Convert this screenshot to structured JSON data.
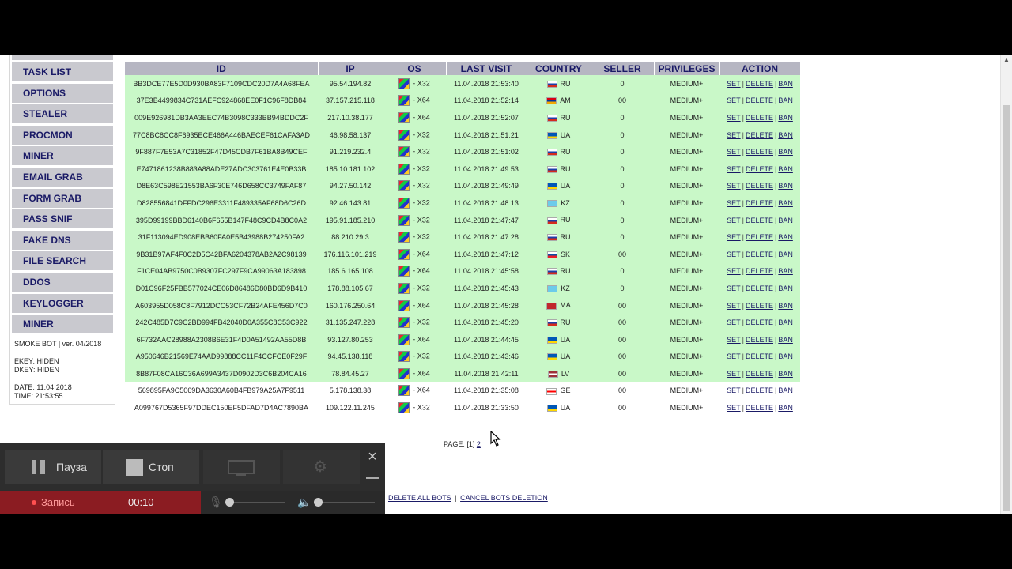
{
  "sidebar": {
    "items": [
      "TASK LIST",
      "OPTIONS",
      "STEALER",
      "PROCMON",
      "MINER",
      "EMAIL GRAB",
      "FORM GRAB",
      "PASS SNIF",
      "FAKE DNS",
      "FILE SEARCH",
      "DDOS",
      "KEYLOGGER",
      "MINER"
    ],
    "version": "SMOKE BOT | ver. 04/2018",
    "ekey": "EKEY: HIDEN",
    "dkey": "DKEY: HIDEN",
    "date": "DATE: 11.04.2018",
    "time": "TIME: 21:53:55"
  },
  "table": {
    "headers": [
      "ID",
      "IP",
      "OS",
      "LAST VISIT",
      "COUNTRY",
      "SELLER",
      "PRIVILEGES",
      "ACTION"
    ],
    "actions": {
      "set": "SET",
      "delete": "DELETE",
      "ban": "BAN",
      "sep": "|"
    },
    "rows": [
      {
        "id": "BB3DCE77E5D0D930BA83F7109CDC20D7A4A68FEA",
        "ip": "95.54.194.82",
        "os": "- X32",
        "visit": "11.04.2018 21:53:40",
        "country": "RU",
        "seller": "0",
        "priv": "MEDIUM+",
        "style": "green"
      },
      {
        "id": "37E3B4499834C731AEFC924868EE0F1C96F8DB84",
        "ip": "37.157.215.118",
        "os": "- X64",
        "visit": "11.04.2018 21:52:14",
        "country": "AM",
        "seller": "00",
        "priv": "MEDIUM+",
        "style": "green"
      },
      {
        "id": "009E926981DB3AA3EEC74B3098C333BB94BDDC2F",
        "ip": "217.10.38.177",
        "os": "- X64",
        "visit": "11.04.2018 21:52:07",
        "country": "RU",
        "seller": "0",
        "priv": "MEDIUM+",
        "style": "green"
      },
      {
        "id": "77C8BC8CC8F6935ECE466A446BAECEF61CAFA3AD",
        "ip": "46.98.58.137",
        "os": "- X32",
        "visit": "11.04.2018 21:51:21",
        "country": "UA",
        "seller": "0",
        "priv": "MEDIUM+",
        "style": "green"
      },
      {
        "id": "9F887F7E53A7C31852F47D45CDB7F61BA8B49CEF",
        "ip": "91.219.232.4",
        "os": "- X32",
        "visit": "11.04.2018 21:51:02",
        "country": "RU",
        "seller": "0",
        "priv": "MEDIUM+",
        "style": "green"
      },
      {
        "id": "E7471861238B883A88ADE27ADC303761E4E0B33B",
        "ip": "185.10.181.102",
        "os": "- X32",
        "visit": "11.04.2018 21:49:53",
        "country": "RU",
        "seller": "0",
        "priv": "MEDIUM+",
        "style": "green"
      },
      {
        "id": "D8E63C598E21553BA6F30E746D658CC3749FAF87",
        "ip": "94.27.50.142",
        "os": "- X32",
        "visit": "11.04.2018 21:49:49",
        "country": "UA",
        "seller": "0",
        "priv": "MEDIUM+",
        "style": "green"
      },
      {
        "id": "D828556841DFFDC296E3311F489335AF68D6C26D",
        "ip": "92.46.143.81",
        "os": "- X32",
        "visit": "11.04.2018 21:48:13",
        "country": "KZ",
        "seller": "0",
        "priv": "MEDIUM+",
        "style": "green"
      },
      {
        "id": "395D99199BBD6140B6F655B147F48C9CD4B8C0A2",
        "ip": "195.91.185.210",
        "os": "- X32",
        "visit": "11.04.2018 21:47:47",
        "country": "RU",
        "seller": "0",
        "priv": "MEDIUM+",
        "style": "green"
      },
      {
        "id": "31F113094ED908EBB60FA0E5B43988B274250FA2",
        "ip": "88.210.29.3",
        "os": "- X32",
        "visit": "11.04.2018 21:47:28",
        "country": "RU",
        "seller": "0",
        "priv": "MEDIUM+",
        "style": "green"
      },
      {
        "id": "9B31B97AF4F0C2D5C42BFA6204378AB2A2C98139",
        "ip": "176.116.101.219",
        "os": "- X64",
        "visit": "11.04.2018 21:47:12",
        "country": "SK",
        "seller": "00",
        "priv": "MEDIUM+",
        "style": "green"
      },
      {
        "id": "F1CE04AB9750C0B9307FC297F9CA99063A183898",
        "ip": "185.6.165.108",
        "os": "- X64",
        "visit": "11.04.2018 21:45:58",
        "country": "RU",
        "seller": "0",
        "priv": "MEDIUM+",
        "style": "green"
      },
      {
        "id": "D01C96F25FBB577024CE06D86486D80BD6D9B410",
        "ip": "178.88.105.67",
        "os": "- X32",
        "visit": "11.04.2018 21:45:43",
        "country": "KZ",
        "seller": "0",
        "priv": "MEDIUM+",
        "style": "green"
      },
      {
        "id": "A603955D058C8F7912DCC53CF72B24AFE456D7C0",
        "ip": "160.176.250.64",
        "os": "- X64",
        "visit": "11.04.2018 21:45:28",
        "country": "MA",
        "seller": "00",
        "priv": "MEDIUM+",
        "style": "green"
      },
      {
        "id": "242C485D7C9C2BD994FB42040D0A355C8C53C922",
        "ip": "31.135.247.228",
        "os": "- X32",
        "visit": "11.04.2018 21:45:20",
        "country": "RU",
        "seller": "00",
        "priv": "MEDIUM+",
        "style": "green"
      },
      {
        "id": "6F732AAC28988A2308B6E31F4D0A51492AA55D8B",
        "ip": "93.127.80.253",
        "os": "- X64",
        "visit": "11.04.2018 21:44:45",
        "country": "UA",
        "seller": "00",
        "priv": "MEDIUM+",
        "style": "green"
      },
      {
        "id": "A950646B21569E74AAD99888CC11F4CCFCE0F29F",
        "ip": "94.45.138.118",
        "os": "- X32",
        "visit": "11.04.2018 21:43:46",
        "country": "UA",
        "seller": "00",
        "priv": "MEDIUM+",
        "style": "green"
      },
      {
        "id": "8B87F08CA16C36A699A3437D0902D3C6B204CA16",
        "ip": "78.84.45.27",
        "os": "- X64",
        "visit": "11.04.2018 21:42:11",
        "country": "LV",
        "seller": "00",
        "priv": "MEDIUM+",
        "style": "green"
      },
      {
        "id": "569895FA9C5069DA3630A60B4FB979A25A7F9511",
        "ip": "5.178.138.38",
        "os": "- X64",
        "visit": "11.04.2018 21:35:08",
        "country": "GE",
        "seller": "00",
        "priv": "MEDIUM+",
        "style": "white"
      },
      {
        "id": "A099767D5365F97DDEC150EF5DFAD7D4AC7890BA",
        "ip": "109.122.11.245",
        "os": "- X32",
        "visit": "11.04.2018 21:33:50",
        "country": "UA",
        "seller": "00",
        "priv": "MEDIUM+",
        "style": "white"
      }
    ]
  },
  "flag_colors": {
    "RU": [
      "#ffffff",
      "#1c3fa8",
      "#d52b1e"
    ],
    "AM": [
      "#d90012",
      "#0033a0",
      "#f2a800"
    ],
    "UA": [
      "#0057b7",
      "#0057b7",
      "#ffd700"
    ],
    "KZ": [
      "#6ccbea",
      "#6ccbea",
      "#6ccbea"
    ],
    "SK": [
      "#ffffff",
      "#0b4ea2",
      "#ee1c25"
    ],
    "MA": [
      "#c1272d",
      "#c1272d",
      "#c1272d"
    ],
    "LV": [
      "#9e3039",
      "#ffffff",
      "#9e3039"
    ],
    "GE": [
      "#ffffff",
      "#ff0000",
      "#ffffff"
    ]
  },
  "pager": {
    "label": "PAGE:",
    "current": "[1]",
    "next": "2"
  },
  "bottom_links": {
    "delete_all": "DELETE ALL BOTS",
    "sep": "|",
    "cancel": "CANCEL BOTS DELETION"
  },
  "recorder": {
    "pause": "Пауза",
    "stop": "Стоп",
    "status": "Запись",
    "time": "00:10",
    "close": "×"
  }
}
